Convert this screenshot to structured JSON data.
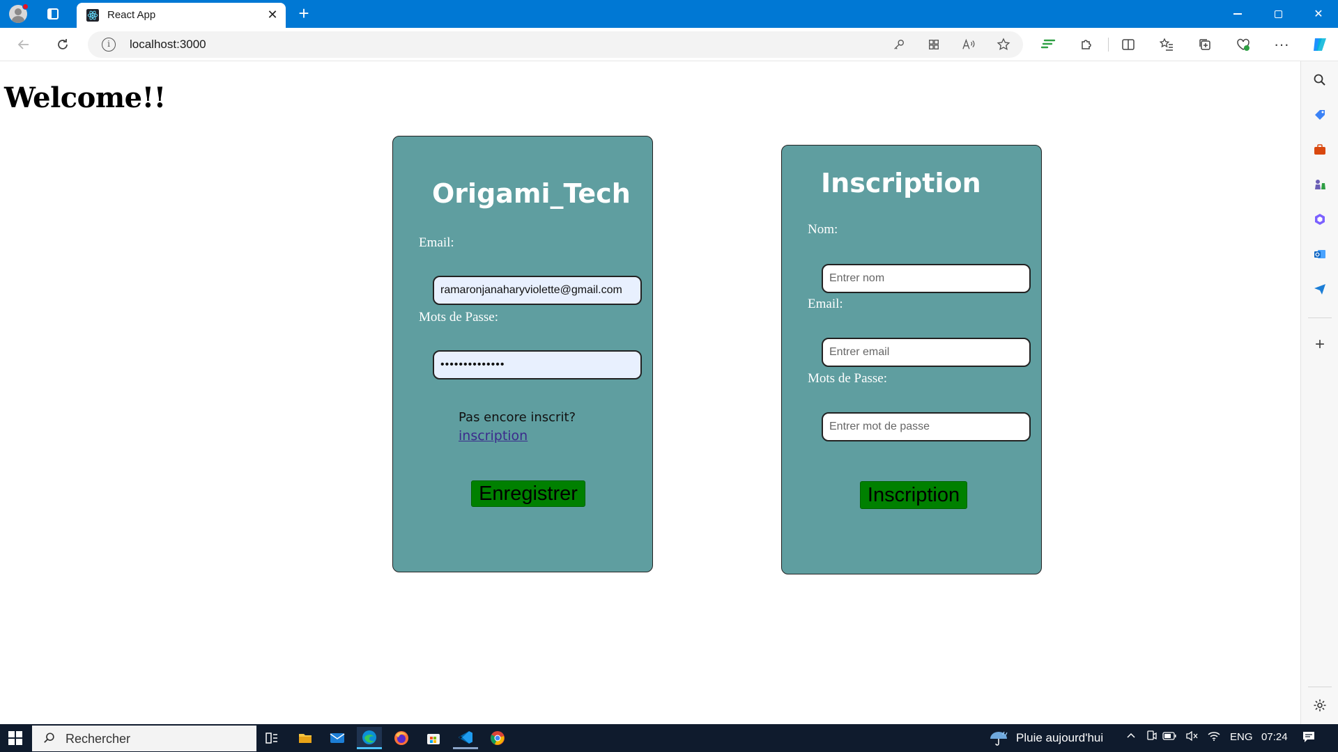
{
  "browser": {
    "tab_title": "React App",
    "tab_close": "✕",
    "new_tab": "+",
    "url": "localhost:3000",
    "accent_color": "#0078d4"
  },
  "page": {
    "heading": "Welcome!!",
    "login": {
      "title": "Origami_Tech",
      "email_label": "Email:",
      "email_value": "ramaronjanaharyviolette@gmail.com",
      "password_label": "Mots de Passe:",
      "password_value": "••••••••••••••",
      "prompt": "Pas encore inscrit?",
      "signup_link": "inscription",
      "submit_label": "Enregistrer"
    },
    "signup": {
      "title": "Inscription",
      "name_label": "Nom:",
      "name_placeholder": "Entrer nom",
      "email_label": "Email:",
      "email_placeholder": "Entrer email",
      "password_label": "Mots de Passe:",
      "password_placeholder": "Entrer mot de passe",
      "submit_label": "Inscription"
    },
    "card_color": "#5f9ea0",
    "button_color": "#008000"
  },
  "taskbar": {
    "search_text": "Rechercher",
    "weather_text": "Pluie aujourd'hui",
    "language": "ENG",
    "time": "07:24"
  }
}
